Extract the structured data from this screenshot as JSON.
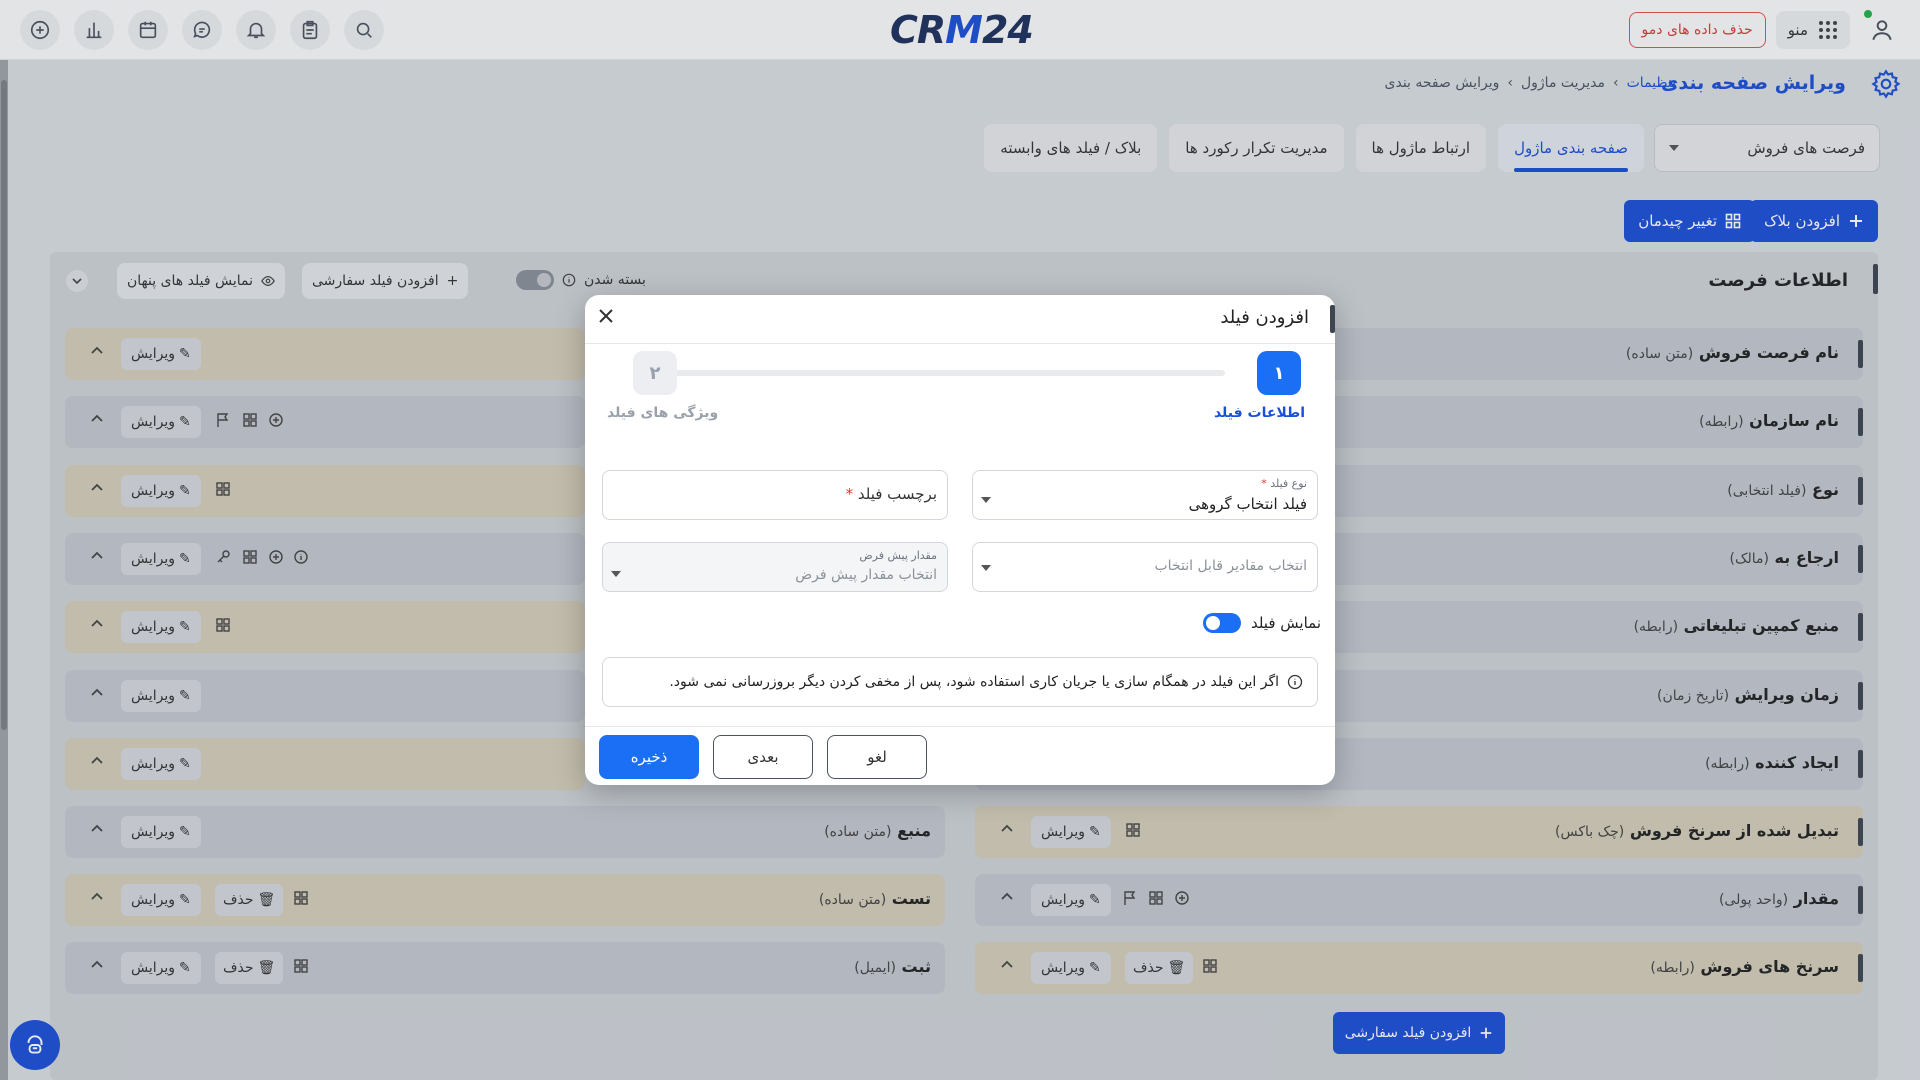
{
  "brand": {
    "logo_prefix": "CR",
    "logo_mid": "M",
    "logo_suffix": "24"
  },
  "topbar": {
    "menu_label": "منو",
    "demo_button": "حذف داده های دمو"
  },
  "header": {
    "title": "ویرایش صفحه بندی",
    "breadcrumbs": [
      "تنظیمات",
      "مدیریت ماژول",
      "ویرایش صفحه بندی"
    ]
  },
  "module_select": {
    "value": "فرصت های فروش"
  },
  "tabs": [
    {
      "label": "صفحه بندی ماژول",
      "active": true
    },
    {
      "label": "ارتباط ماژول ها"
    },
    {
      "label": "مدیریت تکرار رکورد ها"
    },
    {
      "label": "بلاک / فیلد های وابسته"
    }
  ],
  "actions": {
    "add_block": "افزودن بلاک",
    "change_layout": "تغییر چیدمان"
  },
  "section": {
    "title": "اطلاعات فرصت",
    "collapse_label": "بسته شدن",
    "add_custom_field": "افزودن فیلد سفارشی",
    "show_hidden": "نمایش فیلد های پنهان"
  },
  "edit_label": "ویرایش",
  "delete_label": "حذف",
  "rows_right": [
    {
      "name": "نام فرصت فروش",
      "type": "(متن ساده)"
    },
    {
      "name": "نام سازمان",
      "type": "(رابطه)"
    },
    {
      "name": "نوع",
      "type": "(فیلد انتخابی)"
    },
    {
      "name": "ارجاع به",
      "type": "(مالک)"
    },
    {
      "name": "منبع کمپین تبلیغاتی",
      "type": "(رابطه)"
    },
    {
      "name": "زمان ویرایش",
      "type": "(تاریخ زمان)"
    },
    {
      "name": "ایجاد کننده",
      "type": "(رابطه)"
    },
    {
      "name": "تبدیل شده از سرنخ فروش",
      "type": "(چک باکس)"
    },
    {
      "name": "مقدار",
      "type": "(واحد پولی)"
    },
    {
      "name": "سرنخ های فروش",
      "type": "(رابطه)"
    }
  ],
  "rows_left": [
    {
      "name": "منبع",
      "type": "(متن ساده)"
    },
    {
      "name": "تست",
      "type": "(متن ساده)"
    },
    {
      "name": "ثبت",
      "type": "(ایمیل)"
    }
  ],
  "bottom_add_custom": "افزودن فیلد سفارشی",
  "modal": {
    "title": "افزودن فیلد",
    "steps": [
      {
        "num": "۱",
        "label": "اطلاعات فیلد"
      },
      {
        "num": "۲",
        "label": "ویژگی های فیلد"
      }
    ],
    "field_type": {
      "caption": "نوع فیلد",
      "value": "فیلد انتخاب گروهی"
    },
    "field_label": {
      "placeholder": "برچسب فیلد"
    },
    "options": {
      "placeholder": "انتخاب مقادیر قابل انتخاب"
    },
    "default_value": {
      "caption": "مقدار پیش فرض",
      "placeholder": "انتخاب مقدار پیش فرض"
    },
    "show_field": "نمایش فیلد",
    "note": "اگر این فیلد در همگام سازی یا جریان کاری استفاده شود، پس از مخفی کردن دیگر بروزرسانی نمی شود.",
    "cancel": "لغو",
    "next": "بعدی",
    "save": "ذخیره"
  }
}
